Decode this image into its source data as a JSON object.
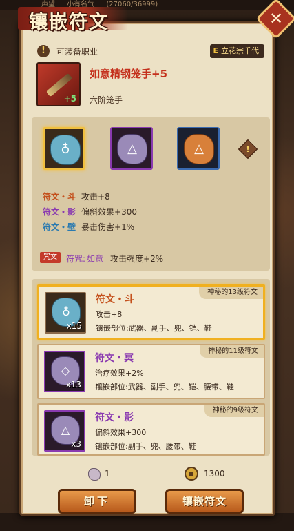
{
  "top_bar": {
    "status_a": "声望",
    "status_b": "小有名气",
    "progress": "(27060/36999)"
  },
  "title": "镶嵌符文",
  "header": {
    "label": "可装备职业",
    "class_letter": "E",
    "class_name": "立花宗千代"
  },
  "item": {
    "name": "如意精钢笼手+5",
    "level_badge": "+5",
    "subtype": "六阶笼手"
  },
  "sockets": [
    {
      "rune": "blue",
      "glyph": "♁",
      "selected": true
    },
    {
      "rune": "purple",
      "glyph": "△",
      "selected": false
    },
    {
      "rune": "orange",
      "glyph": "△",
      "selected": false
    }
  ],
  "socket_stats": [
    {
      "name": "符文・斗",
      "effect": "攻击+8",
      "color": "orange"
    },
    {
      "name": "符文・影",
      "effect": "偏斜效果+300",
      "color": "purple"
    },
    {
      "name": "符文・壁",
      "effect": "暴击伤害+1%",
      "color": "blue"
    }
  ],
  "spell": {
    "stamp": "咒文",
    "label": "符咒:",
    "name": "如意",
    "effect": "攻击强度+2%"
  },
  "rune_list": [
    {
      "name": "符文・斗",
      "tag": "神秘的13级符文",
      "count": "x15",
      "effect": "攻击+8",
      "slots": "镶嵌部位:武器、副手、兜、铠、鞋",
      "color": "orange",
      "selected": true
    },
    {
      "name": "符文・冥",
      "tag": "神秘的11级符文",
      "count": "x13",
      "effect": "治疗效果+2%",
      "slots": "镶嵌部位:武器、副手、兜、铠、腰带、鞋",
      "color": "purple",
      "selected": false
    },
    {
      "name": "符文・影",
      "tag": "神秘的9级符文",
      "count": "x3",
      "effect": "偏斜效果+300",
      "slots": "镶嵌部位:副手、兜、腰带、鞋",
      "color": "purple",
      "selected": false
    }
  ],
  "footer": {
    "stone_count": "1",
    "coin_count": "1300",
    "unload_label": "卸下",
    "embed_label": "镶嵌符文"
  },
  "colors": {
    "accent": "#f0b020",
    "title_red": "#c4301c",
    "panel": "#ece1c5"
  }
}
